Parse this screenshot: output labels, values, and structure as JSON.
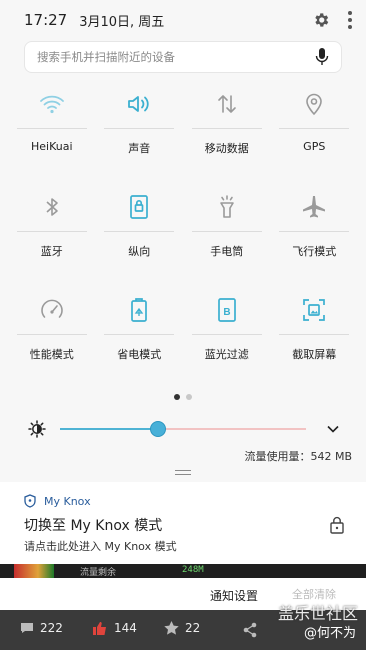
{
  "status": {
    "time": "17:27",
    "date": "3月10日, 周五"
  },
  "search": {
    "placeholder": "搜索手机并扫描附近的设备"
  },
  "tiles": [
    {
      "label": "HeiKuai",
      "icon": "wifi-icon",
      "active": true
    },
    {
      "label": "声音",
      "icon": "volume-icon",
      "active": true
    },
    {
      "label": "移动数据",
      "icon": "mobile-data-icon",
      "active": false
    },
    {
      "label": "GPS",
      "icon": "gps-icon",
      "active": false
    },
    {
      "label": "蓝牙",
      "icon": "bluetooth-icon",
      "active": false
    },
    {
      "label": "纵向",
      "icon": "portrait-lock-icon",
      "active": true
    },
    {
      "label": "手电筒",
      "icon": "flashlight-icon",
      "active": false
    },
    {
      "label": "飞行模式",
      "icon": "airplane-icon",
      "active": false
    },
    {
      "label": "性能模式",
      "icon": "performance-icon",
      "active": false
    },
    {
      "label": "省电模式",
      "icon": "battery-saver-icon",
      "active": true
    },
    {
      "label": "蓝光过滤",
      "icon": "blue-light-filter-icon",
      "active": true
    },
    {
      "label": "截取屏幕",
      "icon": "screenshot-icon",
      "active": true
    }
  ],
  "pager": {
    "pages": 2,
    "current": 1
  },
  "brightness": {
    "level": 0.4
  },
  "usage": {
    "text": "流量使用量：542 MB"
  },
  "knox": {
    "app": "My Knox",
    "title": "切换至 My Knox 模式",
    "subtitle": "请点击此处进入 My Knox 模式"
  },
  "strip": {
    "text1": "流量剩余",
    "text2": "248M"
  },
  "footer": {
    "settings": "通知设置",
    "clear": "全部清除"
  },
  "bottom": {
    "comments": "222",
    "likes": "144",
    "stars": "22"
  },
  "watermark": {
    "line1": "盖乐世社区",
    "line2": "@何不为"
  },
  "colors": {
    "accent": "#3bb0d0",
    "inactive": "#9a9a9a"
  }
}
